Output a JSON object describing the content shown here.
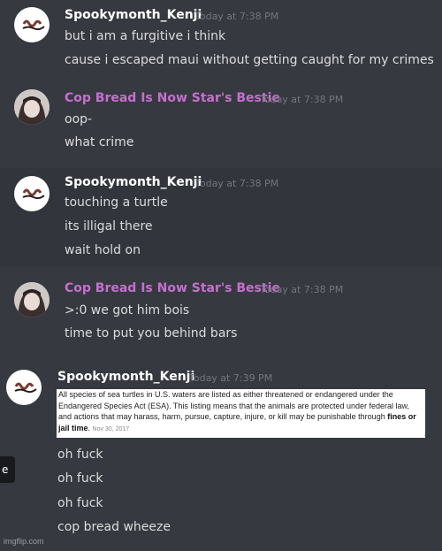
{
  "messages": [
    {
      "author": "Spookymonth_Kenji",
      "timestamp": "Today at 7:38 PM",
      "lines": [
        "but i am a furgitive i think",
        "cause i escaped maui without getting caught for my crimes"
      ]
    },
    {
      "author": "Cop Bread Is Now Star's Bestie",
      "timestamp": "Today at 7:38 PM",
      "lines": [
        "oop-",
        "what crime"
      ]
    },
    {
      "author": "Spookymonth_Kenji",
      "timestamp": "Today at 7:38 PM",
      "lines": [
        "touching a turtle",
        "its illigal there",
        "wait hold on"
      ]
    },
    {
      "author": "Cop Bread Is Now Star's Bestie",
      "timestamp": "Today at 7:38 PM",
      "lines": [
        ">:0 we got him bois",
        "time to put you behind bars"
      ]
    },
    {
      "author": "Spookymonth_Kenji",
      "timestamp": "Today at 7:39 PM",
      "lines": [
        "oh fuck",
        "oh fuck",
        "oh fuck",
        "cop bread wheeze"
      ]
    }
  ],
  "clipping": {
    "text": "All species of sea turtles in U.S. waters are listed as either threatened or endangered under the Endangered Species Act (ESA). This listing means that the animals are protected under federal law, and actions that may harass, harm, pursue, capture, injure, or kill may be punishable through",
    "bold": "fines or jail time",
    "date": "Nov 30, 2017"
  },
  "side_tab_char": "e",
  "watermark": "imgflip.com",
  "colors": {
    "background": "#36393f",
    "kenji_name": "#ffffff",
    "copbread_name": "#c56fd0",
    "timestamp": "#72767d"
  }
}
